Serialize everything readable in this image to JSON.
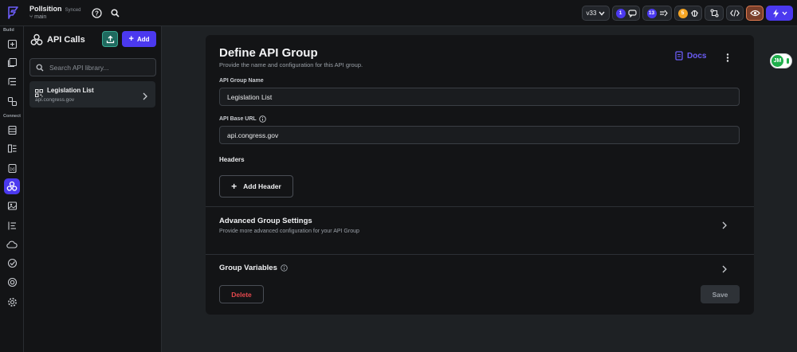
{
  "topbar": {
    "project_name": "Pollsition",
    "sync_status": "Synced",
    "branch": "main",
    "version": "v33",
    "comment_count": "1",
    "change_count": "13",
    "bug_count": "5"
  },
  "rail": {
    "build_label": "Build",
    "connect_label": "Connect"
  },
  "panel": {
    "title": "API Calls",
    "add_label": "Add",
    "search_placeholder": "Search API library...",
    "items": [
      {
        "name": "Legislation List",
        "url": "api.congress.gov"
      }
    ]
  },
  "card": {
    "title": "Define API Group",
    "subtitle": "Provide the name and configuration for this API group.",
    "docs_label": "Docs",
    "group_name_label": "API Group Name",
    "group_name_value": "Legislation List",
    "base_url_label": "API Base URL",
    "base_url_value": "api.congress.gov",
    "headers_label": "Headers",
    "add_header_label": "Add Header",
    "advanced_title": "Advanced Group Settings",
    "advanced_sub": "Provide more advanced configuration for your API Group",
    "variables_title": "Group Variables",
    "delete_label": "Delete",
    "save_label": "Save"
  },
  "avatar": {
    "initials": "JM"
  },
  "colors": {
    "accent": "#4b39ef",
    "delete": "#e5484d",
    "docs": "#6b5cf6",
    "badge_bug": "#f5a524"
  }
}
